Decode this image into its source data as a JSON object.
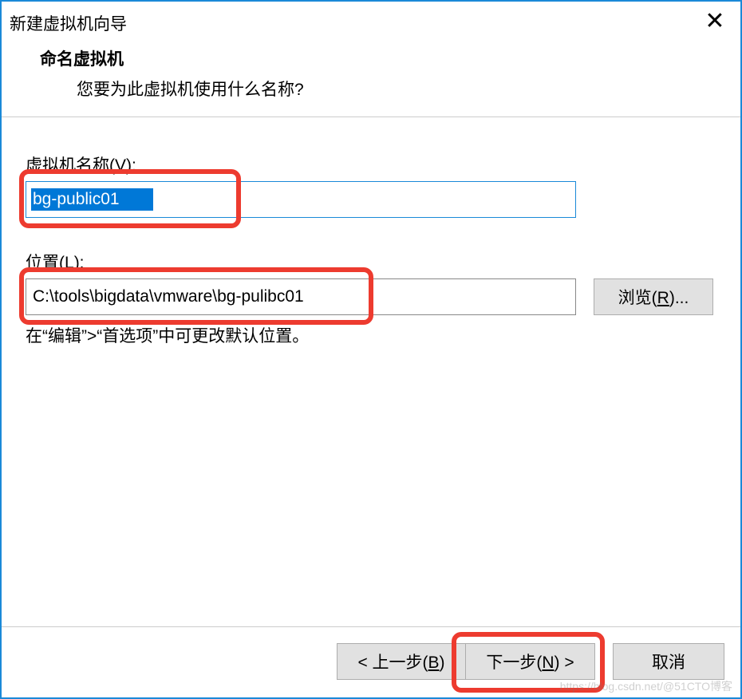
{
  "titlebar": {
    "title": "新建虚拟机向导",
    "close_glyph": "✕"
  },
  "header": {
    "heading": "命名虚拟机",
    "subheading": "您要为此虚拟机使用什么名称?"
  },
  "fields": {
    "vm_name": {
      "label_prefix": "虚拟机名称(",
      "label_key": "V",
      "label_suffix": "):",
      "value": "bg-public01"
    },
    "location": {
      "label_prefix": "位置(",
      "label_key": "L",
      "label_suffix": "):",
      "value": "C:\\tools\\bigdata\\vmware\\bg-pulibc01",
      "browse_prefix": "浏览(",
      "browse_key": "R",
      "browse_suffix": ")..."
    },
    "hint": "在“编辑”>“首选项”中可更改默认位置。"
  },
  "footer": {
    "back_prefix": "< 上一步(",
    "back_key": "B",
    "back_suffix": ")",
    "next_prefix": "下一步(",
    "next_key": "N",
    "next_suffix": ") >",
    "cancel": "取消"
  },
  "watermark": "https://blog.csdn.net/@51CTO博客"
}
